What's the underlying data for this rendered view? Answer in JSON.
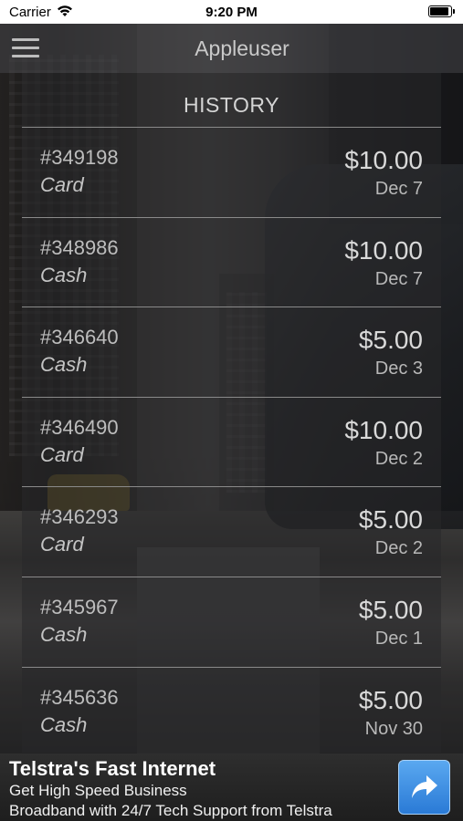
{
  "status_bar": {
    "carrier": "Carrier",
    "time": "9:20 PM"
  },
  "nav": {
    "title": "Appleuser",
    "menu_icon": "hamburger-menu-icon"
  },
  "history": {
    "title": "HISTORY",
    "items": [
      {
        "id": "#349198",
        "method": "Card",
        "amount": "$10.00",
        "date": "Dec 7"
      },
      {
        "id": "#348986",
        "method": "Cash",
        "amount": "$10.00",
        "date": "Dec 7"
      },
      {
        "id": "#346640",
        "method": "Cash",
        "amount": "$5.00",
        "date": "Dec 3"
      },
      {
        "id": "#346490",
        "method": "Card",
        "amount": "$10.00",
        "date": "Dec 2"
      },
      {
        "id": "#346293",
        "method": "Card",
        "amount": "$5.00",
        "date": "Dec 2"
      },
      {
        "id": "#345967",
        "method": "Cash",
        "amount": "$5.00",
        "date": "Dec 1"
      },
      {
        "id": "#345636",
        "method": "Cash",
        "amount": "$5.00",
        "date": "Nov 30"
      }
    ]
  },
  "ad": {
    "title": "Telstra's Fast Internet",
    "line1": "Get High Speed Business",
    "line2": "Broadband with 24/7 Tech Support from Telstra",
    "button_icon": "share-arrow-icon"
  }
}
